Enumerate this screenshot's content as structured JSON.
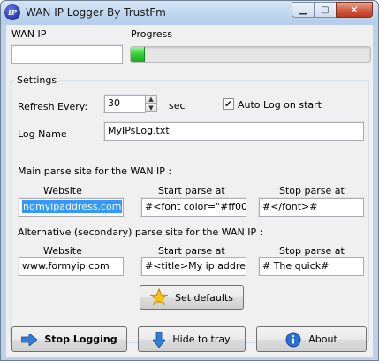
{
  "window": {
    "title": "WAN IP Logger By TrustFm",
    "app_icon_text": "IP",
    "minimize_glyph": "▁",
    "maximize_glyph": "▢",
    "close_glyph": "✕"
  },
  "wan_ip": {
    "label": "WAN IP",
    "value": ""
  },
  "progress": {
    "label": "Progress",
    "percent": 6
  },
  "settings": {
    "group_label": "Settings",
    "refresh_label": "Refresh Every:",
    "refresh_value": "30",
    "refresh_unit": "sec",
    "auto_log_label": "Auto Log on start",
    "auto_log_checked": true,
    "log_name_label": "Log Name",
    "log_name_value": "MyIPsLog.txt",
    "main_title": "Main parse site for the WAN IP :",
    "alt_title": "Alternative (secondary) parse site for the WAN IP :",
    "col_website": "Website",
    "col_start": "Start parse at",
    "col_stop": "Stop parse at",
    "main": {
      "website": "ndmyipaddress.com",
      "start": "#<font color=\"#ff000",
      "stop": "#</font>#"
    },
    "alt": {
      "website": "www.formyip.com",
      "start": "#<title>My ip addres",
      "stop": "# The quick#"
    },
    "defaults_button": "Set defaults"
  },
  "buttons": {
    "stop_logging": "Stop Logging",
    "hide_to_tray": "Hide to tray",
    "about": "About"
  },
  "icons": {
    "star": "star-icon",
    "stop": "arrow-right-icon",
    "tray": "arrow-down-icon",
    "about": "info-icon"
  },
  "colors": {
    "progress_fill": "#32cd32",
    "selection": "#3399ff",
    "close_button": "#c0391c"
  }
}
